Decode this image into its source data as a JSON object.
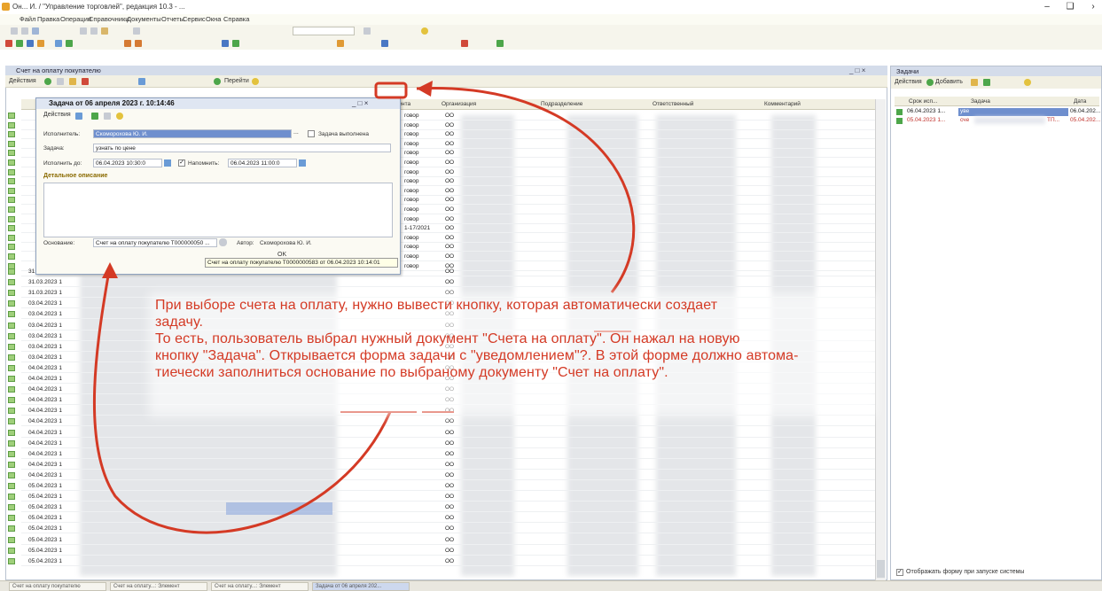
{
  "window": {
    "title": "Он... И. / \"Управление торговлей\", редакция 10.3 - ..."
  },
  "menu": [
    "Файл",
    "Правка",
    "Операции",
    "Справочники",
    "Документы",
    "Отчеты",
    "Сервис",
    "Окна",
    "Справка"
  ],
  "list_window": {
    "title": "Счет на оплату покупателю",
    "actions_label": "Действия",
    "goto_label": "Перейти",
    "columns": [
      "Контрагента",
      "Организация",
      "Подразделение",
      "Ответственный",
      "Комментарий"
    ],
    "rows_top_label": "говор",
    "row_date_label": "1-17/2021",
    "rows": [
      "31.03.2023 1",
      "31.03.2023 1",
      "31.03.2023 1",
      "03.04.2023 1",
      "03.04.2023 1",
      "03.04.2023 1",
      "03.04.2023 1",
      "03.04.2023 1",
      "03.04.2023 1",
      "04.04.2023 1",
      "04.04.2023 1",
      "04.04.2023 1",
      "04.04.2023 1",
      "04.04.2023 1",
      "04.04.2023 1",
      "04.04.2023 1",
      "04.04.2023 1",
      "04.04.2023 1",
      "04.04.2023 1",
      "04.04.2023 1",
      "05.04.2023 1",
      "05.04.2023 1",
      "05.04.2023 1",
      "05.04.2023 1",
      "05.04.2023 1",
      "05.04.2023 1",
      "05.04.2023 1",
      "05.04.2023 1"
    ],
    "org_prefix": "ОО"
  },
  "task_form": {
    "title": "Задача от 06 апреля 2023 г. 10:14:46",
    "actions_label": "Действия",
    "executor_label": "Исполнитель:",
    "executor_value": "Скоморохова Ю. И.",
    "task_done_label": "Задача выполнена",
    "task_label": "Задача:",
    "task_value": "узнать по цене",
    "execute_by_label": "Исполнить до:",
    "execute_by_value": "06.04.2023 10:30:0",
    "remind_label": "Напомнить:",
    "remind_value": "06.04.2023 11:00:0",
    "detail_title": "Детальное описание",
    "basis_label": "Основание:",
    "basis_value": "Счет на оплату покупателю Т000000050 ...",
    "author_label": "Автор:",
    "author_value": "Скоморохова Ю. И.",
    "ok_label": "OK",
    "tooltip": "Счет на оплату покупателю Т0000000583 от 06.04.2023 10:14:01"
  },
  "tasks_panel": {
    "title": "Задачи",
    "actions_label": "Действия",
    "add_label": "Добавить",
    "col_deadline": "Срок исп...",
    "col_task": "Задача",
    "col_date": "Дата",
    "rows": [
      {
        "deadline": "06.04.2023 1...",
        "task": "уве",
        "date": "06.04.202..."
      },
      {
        "deadline": "05.04.2023 1...",
        "task": "сче",
        "extra": "ТП...",
        "date": "05.04.202..."
      }
    ],
    "show_on_start_label": "Отображать форму при запуске системы"
  },
  "annotation": {
    "lines": [
      "При выборе счета на оплату, нужно вывести кнопку, которая автоматически создает",
      "задачу.",
      "То есть, пользователь выбрал нужный документ \"Счета на оплату\". Он нажал на новую",
      "кнопку \"Задача\". Открывается форма задачи с \"уведомлением\"?. В этой форме должно автома-",
      "тиечески заполниться основание по выбраному документу  \"Счет на оплату\"."
    ]
  },
  "taskbar": {
    "tabs": [
      "Счет на оплату покупателю",
      "Счет на оплату...: Элемент",
      "Счет на оплату...: Элемент",
      "Задача от 06 апреля 202..."
    ]
  },
  "colors": {
    "annotation": "#d43a25",
    "selection": "#6f8fce",
    "panel_header": "#d4dcea"
  }
}
